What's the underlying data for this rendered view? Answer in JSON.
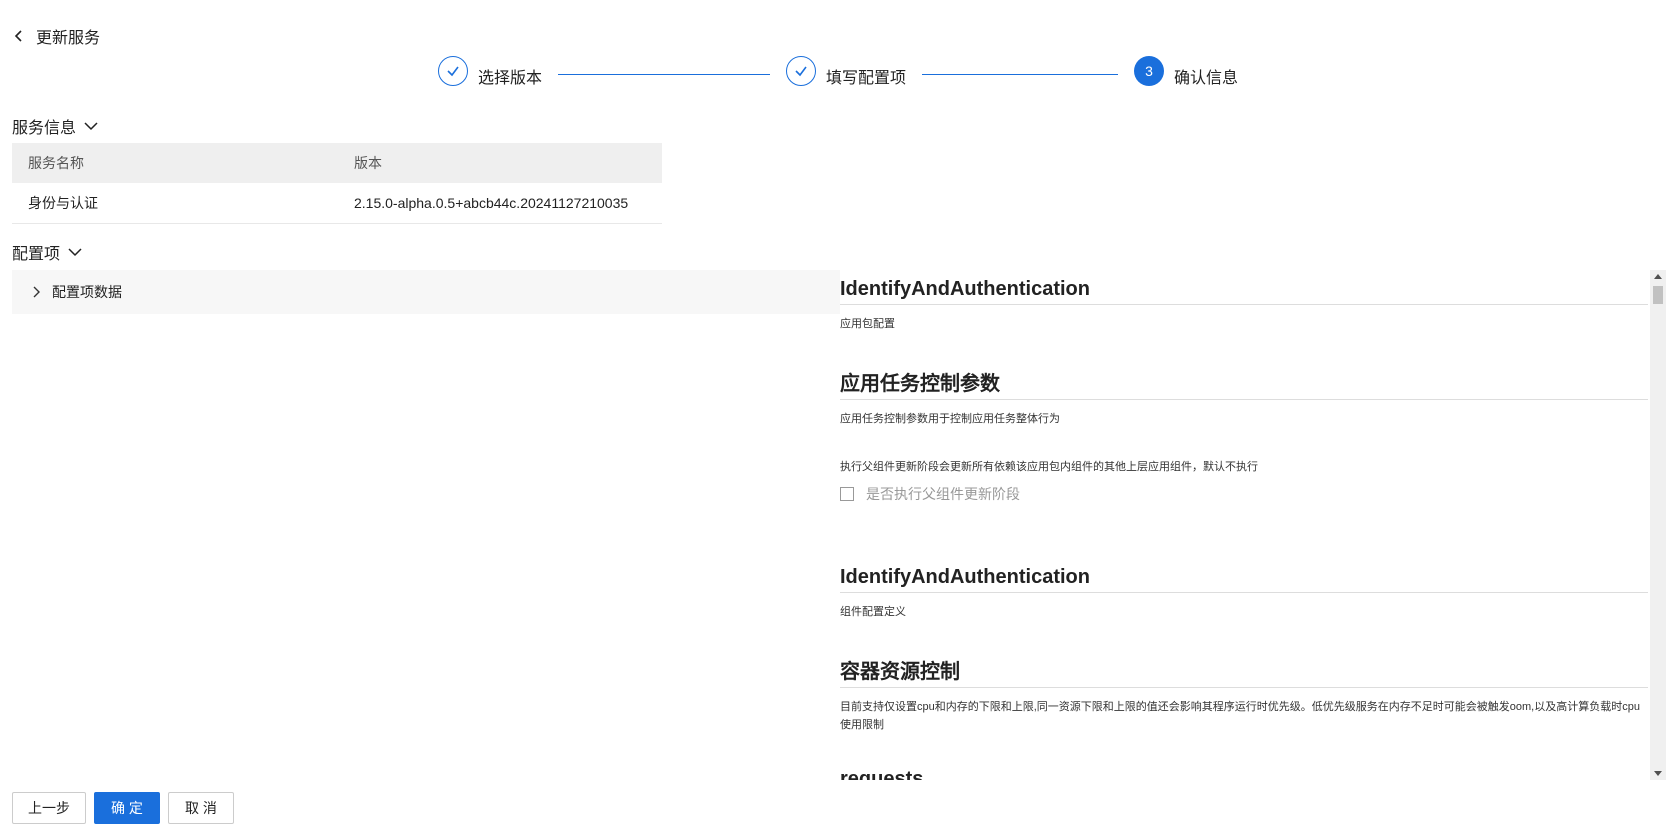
{
  "header": {
    "back_label": "更新服务"
  },
  "steps": [
    {
      "label": "选择版本",
      "status": "done"
    },
    {
      "label": "填写配置项",
      "status": "done"
    },
    {
      "label": "确认信息",
      "status": "active",
      "number": "3"
    }
  ],
  "service_section": {
    "title": "服务信息",
    "columns": [
      "服务名称",
      "版本"
    ],
    "rows": [
      {
        "name": "身份与认证",
        "version": "2.15.0-alpha.0.5+abcb44c.20241127210035"
      }
    ]
  },
  "config_section": {
    "title": "配置项",
    "panel_label": "配置项数据"
  },
  "docs": {
    "h1": "IdentifyAndAuthentication",
    "p1": "应用包配置",
    "h2": "应用任务控制参数",
    "p2": "应用任务控制参数用于控制应用任务整体行为",
    "p3": "执行父组件更新阶段会更新所有依赖该应用包内组件的其他上层应用组件，默认不执行",
    "checkbox_label": "是否执行父组件更新阶段",
    "h3": "IdentifyAndAuthentication",
    "p4": "组件配置定义",
    "h4": "容器资源控制",
    "p5": "目前支持仅设置cpu和内存的下限和上限,同一资源下限和上限的值还会影响其程序运行时优先级。低优先级服务在内存不足时可能会被触发oom,以及高计算负载时cpu使用限制",
    "h5": "requests"
  },
  "footer": {
    "prev": "上一步",
    "confirm": "确 定",
    "cancel": "取 消"
  },
  "colors": {
    "primary": "#1a6fdc"
  }
}
